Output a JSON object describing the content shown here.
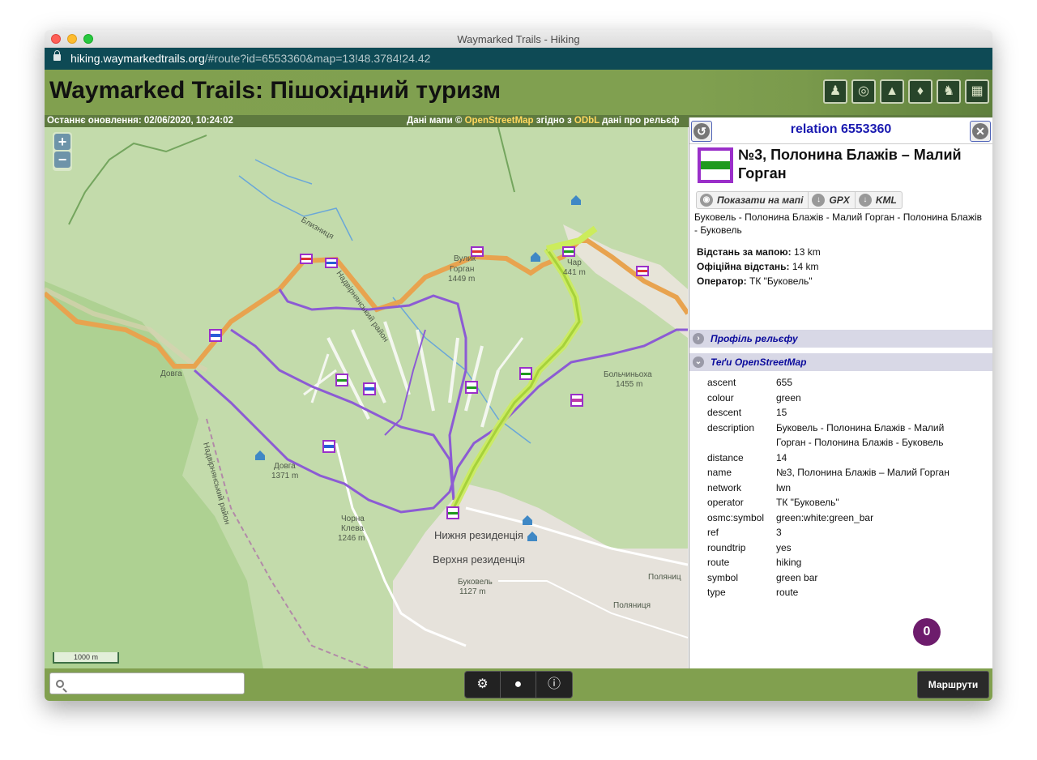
{
  "window": {
    "title": "Waymarked Trails - Hiking"
  },
  "browser": {
    "url_host": "hiking.waymarkedtrails.org",
    "url_path": "/#route?id=6553360&map=13!48.3784!24.42"
  },
  "header": {
    "site_title": "Waymarked Trails: Пішохідний туризм",
    "theme_icons": [
      "hiking-icon",
      "cycling-icon",
      "mtb-icon",
      "skating-icon",
      "riding-icon",
      "slopes-icon"
    ]
  },
  "status": {
    "last_update": "Останнє оновлення: 02/06/2020, 10:24:02",
    "attrib_prefix": "Дані мапи ©",
    "osm_link": "OpenStreetMap",
    "attrib_mid": "згідно з",
    "odbl_link": "ODbL",
    "attrib_suffix": "дані про рельєф"
  },
  "map": {
    "zoom_in": "+",
    "zoom_out": "−",
    "scale": "1000 m",
    "labels": {
      "bliznytsia": "Близниця",
      "nadvirna": "Надвірнянський район",
      "vulyk": "Вулик",
      "hhorhan": "Горган",
      "hhorhan_elev": "1449 m",
      "chari": "Чар",
      "chari_elev": "441 m",
      "dovha": "Довга",
      "dovha2": "Довга",
      "dovha2_elev": "1371 m",
      "bolchyn": "Больчиньоха",
      "bolchyn_elev": "1455 m",
      "chorna": "Чорна",
      "kleva": "Клева",
      "kleva_elev": "1246 m",
      "nyzhnia": "Нижня резиденція",
      "verkhnia": "Верхня резиденція",
      "bukovel": "Буковель",
      "bukovel_elev": "1127 m",
      "polianytsia": "Поляниця",
      "polianytsia2": "Поляниц",
      "nadvir_dist": "Надвірнянський район"
    }
  },
  "panel": {
    "title": "relation 6553360",
    "route_name": "№3, Полонина Блажів – Малий Горган",
    "actions": {
      "show": "Показати на мапі",
      "gpx": "GPX",
      "kml": "KML"
    },
    "description": "Буковель - Полонина Блажів - Малий Горган - Полонина Блажів - Буковель",
    "map_distance_label": "Відстань за мапою:",
    "map_distance": "13 km",
    "official_distance_label": "Офіційна відстань:",
    "official_distance": "14 km",
    "operator_label": "Оператор:",
    "operator": "ТК \"Буковель\"",
    "section_profile": "Профіль рельєфу",
    "section_tags": "Теґи OpenStreetMap",
    "tags": [
      {
        "k": "ascent",
        "v": "655"
      },
      {
        "k": "colour",
        "v": "green"
      },
      {
        "k": "descent",
        "v": "15"
      },
      {
        "k": "description",
        "v": "Буковель - Полонина Блажів - Малий Горган - Полонина Блажів - Буковель"
      },
      {
        "k": "distance",
        "v": "14"
      },
      {
        "k": "name",
        "v": "№3, Полонина Блажів – Малий Горган"
      },
      {
        "k": "network",
        "v": "lwn"
      },
      {
        "k": "operator",
        "v": "ТК \"Буковель\""
      },
      {
        "k": "osmc:symbol",
        "v": "green:white:green_bar"
      },
      {
        "k": "ref",
        "v": "3"
      },
      {
        "k": "roundtrip",
        "v": "yes"
      },
      {
        "k": "route",
        "v": "hiking"
      },
      {
        "k": "symbol",
        "v": "green bar"
      },
      {
        "k": "type",
        "v": "route"
      }
    ]
  },
  "footer": {
    "search_value": "",
    "routes_button": "Маршрути",
    "badge": "0"
  }
}
